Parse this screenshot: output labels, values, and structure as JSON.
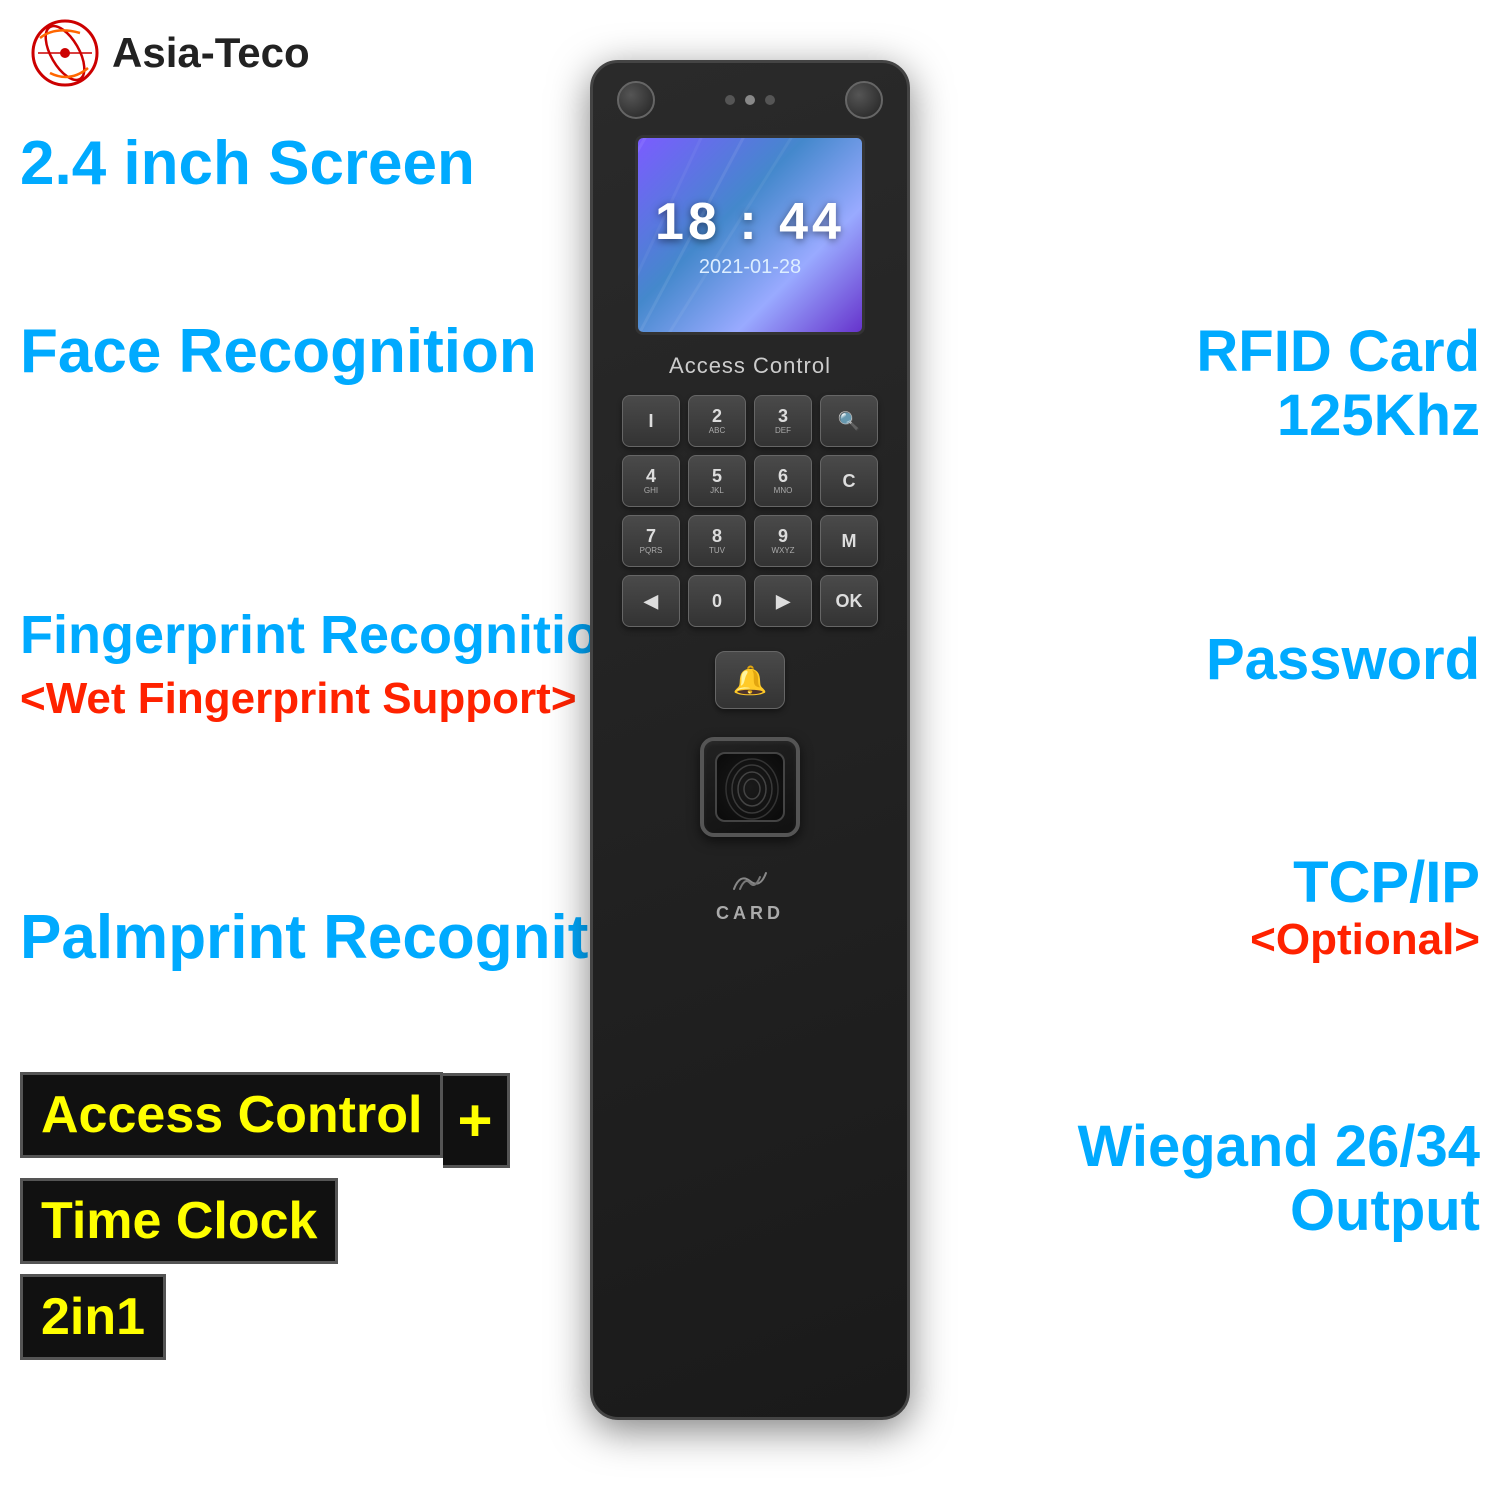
{
  "brand": {
    "logo_text": "Asia-Teco"
  },
  "left": {
    "screen_size_label": "2.4 inch Screen",
    "face_recognition": "Face Recognition",
    "fingerprint_recognition": "Fingerprint  Recognition",
    "wet_fingerprint": "<Wet Fingerprint Support>",
    "palmprint_recognition": "Palmprint Recognition"
  },
  "right": {
    "rfid_card": "RFID Card",
    "freq": "125Khz",
    "password": "Password",
    "tcp_ip": "TCP/IP",
    "optional": "<Optional>",
    "wiegand": "Wiegand 26/34",
    "output": "Output"
  },
  "badges": {
    "access_control": "Access Control",
    "plus": "+",
    "time_clock": "Time Clock",
    "two_in_one": "2in1"
  },
  "device": {
    "screen_time": "18 : 44",
    "screen_date": "2021-01-28",
    "access_control_label": "Access Control",
    "card_label": "CARD",
    "keys": [
      {
        "main": "I",
        "sub": ""
      },
      {
        "main": "2",
        "sub": "ABC"
      },
      {
        "main": "3",
        "sub": "DEF"
      },
      {
        "main": "🔍",
        "sub": ""
      },
      {
        "main": "4",
        "sub": "GHI"
      },
      {
        "main": "5",
        "sub": "JKL"
      },
      {
        "main": "6",
        "sub": "MNO"
      },
      {
        "main": "C",
        "sub": ""
      },
      {
        "main": "7",
        "sub": "PQRS"
      },
      {
        "main": "8",
        "sub": "TUV"
      },
      {
        "main": "9",
        "sub": "WXYZ"
      },
      {
        "main": "M",
        "sub": ""
      },
      {
        "main": "◀",
        "sub": ""
      },
      {
        "main": "0",
        "sub": ""
      },
      {
        "main": "▶",
        "sub": ""
      },
      {
        "main": "OK",
        "sub": ""
      }
    ]
  }
}
